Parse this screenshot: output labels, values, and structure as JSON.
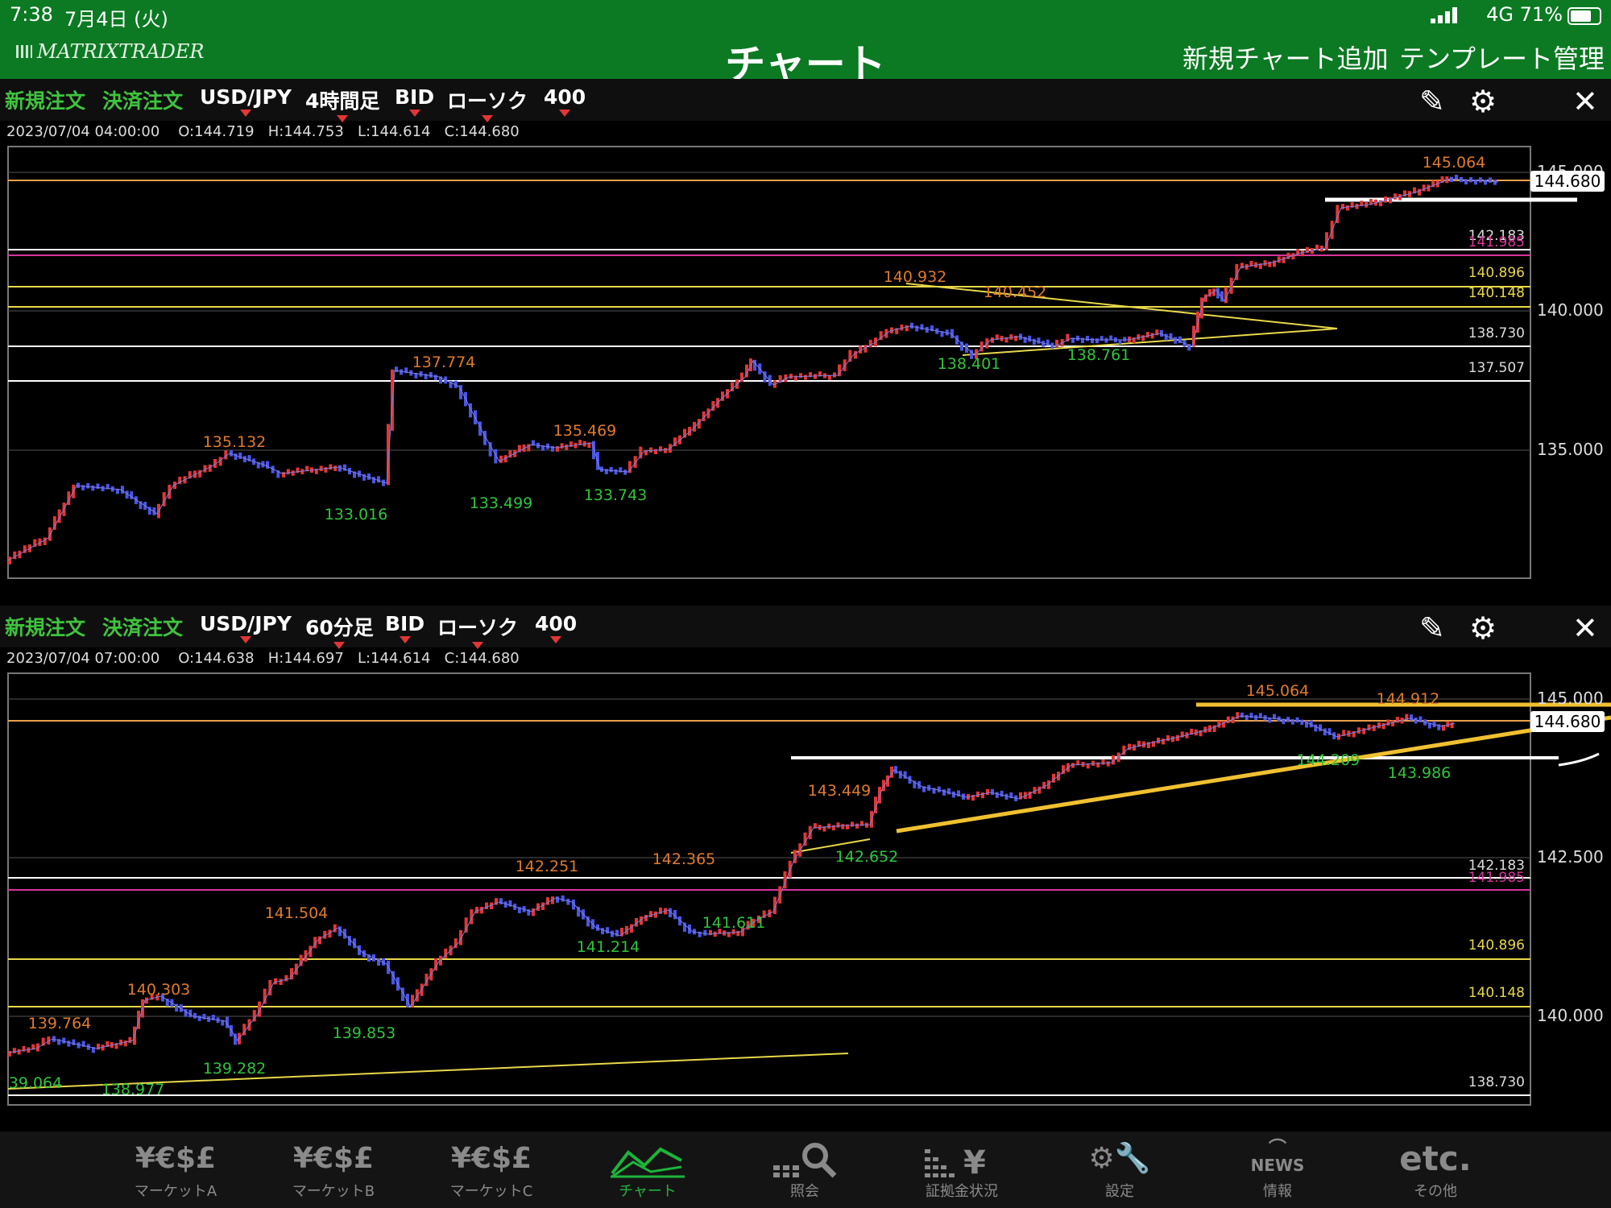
{
  "status": {
    "time": "7:38",
    "date": "7月4日 (火)",
    "network": "4G",
    "battery": "71%"
  },
  "header": {
    "logo": "MATRIXTRADER",
    "title": "チャート",
    "add_chart": "新規チャート追加",
    "template": "テンプレート管理"
  },
  "chart1": {
    "toolbar": {
      "new_order": "新規注文",
      "settle_order": "決済注文",
      "pair": "USD/JPY",
      "timeframe": "4時間足",
      "price_type": "BID",
      "chart_type": "ローソク",
      "count": "400"
    },
    "ohlc": {
      "datetime": "2023/07/04 04:00:00",
      "open": "O:144.719",
      "high": "H:144.753",
      "low": "L:144.614",
      "close": "C:144.680"
    },
    "current_price": "144.680",
    "axis_labels": [
      "145.000",
      "140.000",
      "135.000"
    ],
    "level_labels": [
      "142.183",
      "141.985",
      "140.896",
      "140.148",
      "138.730",
      "137.507"
    ],
    "peak_labels": [
      "145.064",
      "140.932",
      "140.452",
      "137.774",
      "135.132",
      "135.469"
    ],
    "trough_labels": [
      "138.401",
      "138.761",
      "133.016",
      "133.499",
      "133.743"
    ]
  },
  "chart2": {
    "toolbar": {
      "new_order": "新規注文",
      "settle_order": "決済注文",
      "pair": "USD/JPY",
      "timeframe": "60分足",
      "price_type": "BID",
      "chart_type": "ローソク",
      "count": "400"
    },
    "ohlc": {
      "datetime": "2023/07/04 07:00:00",
      "open": "O:144.638",
      "high": "H:144.697",
      "low": "L:144.614",
      "close": "C:144.680"
    },
    "current_price": "144.680",
    "axis_labels": [
      "145.000",
      "142.500",
      "140.000"
    ],
    "level_labels": [
      "142.183",
      "141.985",
      "140.896",
      "140.148",
      "138.730"
    ],
    "peak_labels": [
      "145.064",
      "144.912",
      "143.449",
      "142.251",
      "142.365",
      "141.504",
      "140.303",
      "139.764"
    ],
    "trough_labels": [
      "144.209",
      "143.986",
      "142.652",
      "141.214",
      "141.611",
      "139.853",
      "139.282",
      "39.064",
      "138.977"
    ]
  },
  "tabs": [
    {
      "icon": "¥€$£",
      "label": "マーケットA"
    },
    {
      "icon": "¥€$£",
      "label": "マーケットB"
    },
    {
      "icon": "¥€$£",
      "label": "マーケットC"
    },
    {
      "icon": "",
      "label": "チャート"
    },
    {
      "icon": "",
      "label": "照会"
    },
    {
      "icon": "¥",
      "label": "証拠金状況"
    },
    {
      "icon": "",
      "label": "設定"
    },
    {
      "icon": "NEWS",
      "label": "情報"
    },
    {
      "icon": "etc.",
      "label": "その他"
    }
  ],
  "colors": {
    "header_green": "#0b7a22",
    "bull": "#e23636",
    "bear": "#4a55e6",
    "peak": "#e07a2c",
    "trough": "#2fc53b",
    "level_yellow": "#e8d84a",
    "level_pink": "#d8359a",
    "trend": "#f0c030",
    "current": "#e8a04a"
  }
}
